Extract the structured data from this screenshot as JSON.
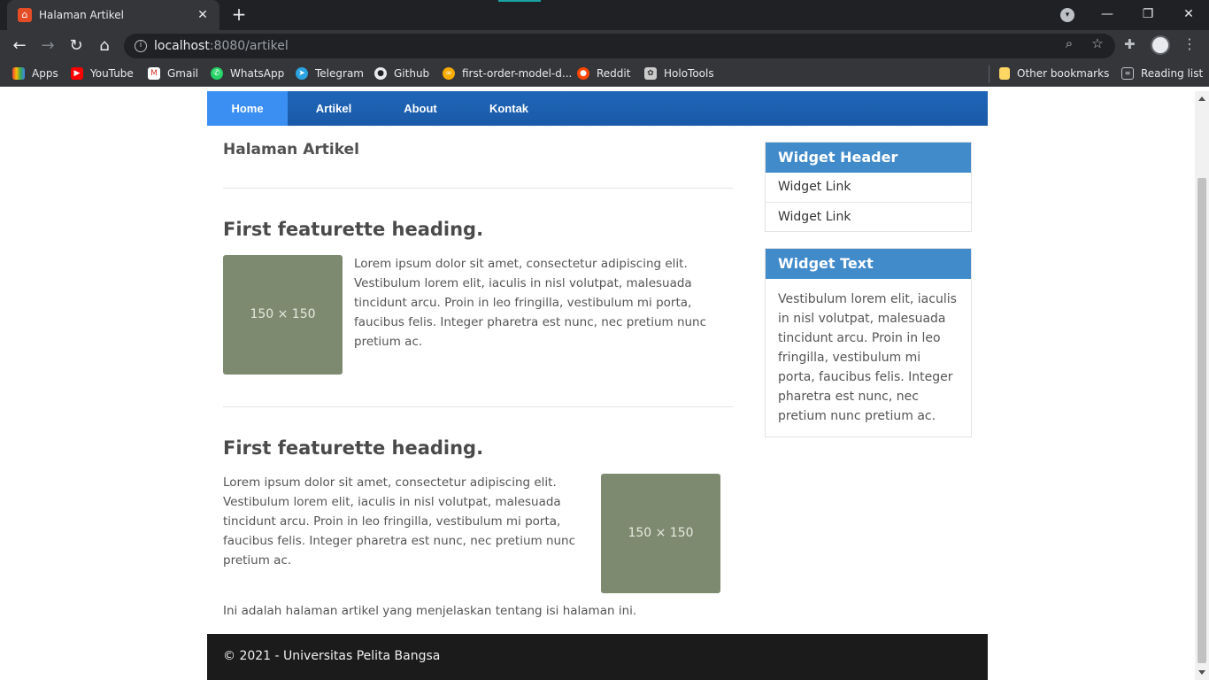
{
  "browser": {
    "tab_title": "Halaman Artikel",
    "tab_close": "✕",
    "new_tab": "+",
    "url_host": "localhost",
    "url_path": ":8080/artikel",
    "window_controls": {
      "minimize": "—",
      "restore": "❐",
      "close": "✕"
    },
    "bookmarks": [
      {
        "label": "Apps",
        "icon": "apps-grid-icon",
        "color": "#ea4335"
      },
      {
        "label": "YouTube",
        "icon": "youtube-icon",
        "color": "#ff0000"
      },
      {
        "label": "Gmail",
        "icon": "gmail-icon",
        "color": "#d93025"
      },
      {
        "label": "WhatsApp",
        "icon": "whatsapp-icon",
        "color": "#25d366"
      },
      {
        "label": "Telegram",
        "icon": "telegram-icon",
        "color": "#2aa3e0"
      },
      {
        "label": "Github",
        "icon": "github-icon",
        "color": "#e8eaed"
      },
      {
        "label": "first-order-model-d...",
        "icon": "colab-icon",
        "color": "#f9ab00"
      },
      {
        "label": "Reddit",
        "icon": "reddit-icon",
        "color": "#ff4500"
      },
      {
        "label": "HoloTools",
        "icon": "holotools-icon",
        "color": "#cccccc"
      },
      {
        "label": "Other bookmarks",
        "icon": "folder-icon",
        "color": "#fdd663"
      },
      {
        "label": "Reading list",
        "icon": "reading-list-icon",
        "color": "#bdc1c6"
      }
    ]
  },
  "site": {
    "nav": [
      {
        "label": "Home",
        "active": true
      },
      {
        "label": "Artikel",
        "active": false
      },
      {
        "label": "About",
        "active": false
      },
      {
        "label": "Kontak",
        "active": false
      }
    ],
    "page_heading": "Halaman Artikel",
    "features": [
      {
        "heading": "First featurette heading.",
        "image_label": "150 × 150",
        "text": "Lorem ipsum dolor sit amet, consectetur adipiscing elit. Vestibulum lorem elit, iaculis in nisl volutpat, malesuada tincidunt arcu. Proin in leo fringilla, vestibulum mi porta, faucibus felis. Integer pharetra est nunc, nec pretium nunc pretium ac."
      },
      {
        "heading": "First featurette heading.",
        "image_label": "150 × 150",
        "text": "Lorem ipsum dolor sit amet, consectetur adipiscing elit. Vestibulum lorem elit, iaculis in nisl volutpat, malesuada tincidunt arcu. Proin in leo fringilla, vestibulum mi porta, faucibus felis. Integer pharetra est nunc, nec pretium nunc pretium ac."
      }
    ],
    "footer_note": "Ini adalah halaman artikel yang menjelaskan tentang isi halaman ini.",
    "widgets": {
      "links_header": "Widget Header",
      "links": [
        "Widget Link",
        "Widget Link"
      ],
      "text_header": "Widget Text",
      "text": "Vestibulum lorem elit, iaculis in nisl volutpat, malesuada tincidunt arcu. Proin in leo fringilla, vestibulum mi porta, faucibus felis. Integer pharetra est nunc, nec pretium nunc pretium ac."
    },
    "copyright": "© 2021 - Universitas Pelita Bangsa"
  },
  "colors": {
    "navbar": "#1f66b8",
    "nav_active": "#3b8ff2",
    "widget_header": "#428bca",
    "placeholder": "#7e8a70",
    "footer": "#1b1b1b"
  }
}
